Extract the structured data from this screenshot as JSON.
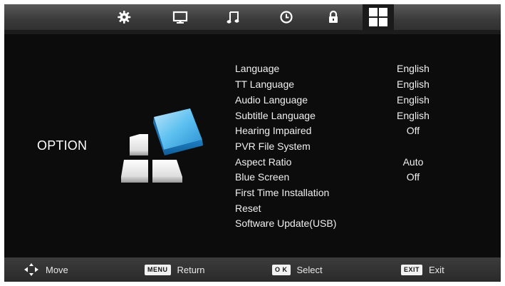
{
  "page": {
    "title": "OPTION"
  },
  "tabs": [
    {
      "icon": "gear-icon",
      "label": "Picture"
    },
    {
      "icon": "monitor-icon",
      "label": "Screen"
    },
    {
      "icon": "music-note-icon",
      "label": "Sound"
    },
    {
      "icon": "clock-icon",
      "label": "Time"
    },
    {
      "icon": "lock-icon",
      "label": "Lock"
    },
    {
      "icon": "option-grid-icon",
      "label": "Option",
      "active": true
    }
  ],
  "menu": {
    "items": [
      {
        "label": "Language",
        "value": "English"
      },
      {
        "label": "TT Language",
        "value": "English"
      },
      {
        "label": "Audio Language",
        "value": "English"
      },
      {
        "label": "Subtitle Language",
        "value": "English"
      },
      {
        "label": "Hearing Impaired",
        "value": "Off"
      },
      {
        "label": "PVR File System",
        "value": ""
      },
      {
        "label": "Aspect Ratio",
        "value": "Auto"
      },
      {
        "label": "Blue Screen",
        "value": "Off"
      },
      {
        "label": "First Time Installation",
        "value": ""
      },
      {
        "label": "Reset",
        "value": ""
      },
      {
        "label": "Software Update(USB)",
        "value": ""
      }
    ]
  },
  "help": {
    "move": {
      "icon": "dpad-arrows-icon",
      "label": "Move"
    },
    "return": {
      "key": "MENU",
      "label": "Return"
    },
    "select": {
      "key": "O K",
      "label": "Select"
    },
    "exit": {
      "key": "EXIT",
      "label": "Exit"
    }
  },
  "colors": {
    "background": "#0c0c0c",
    "text": "#f0f0f0",
    "accent_blue": "#3aa6e0",
    "bar": "#3a3a3a"
  }
}
